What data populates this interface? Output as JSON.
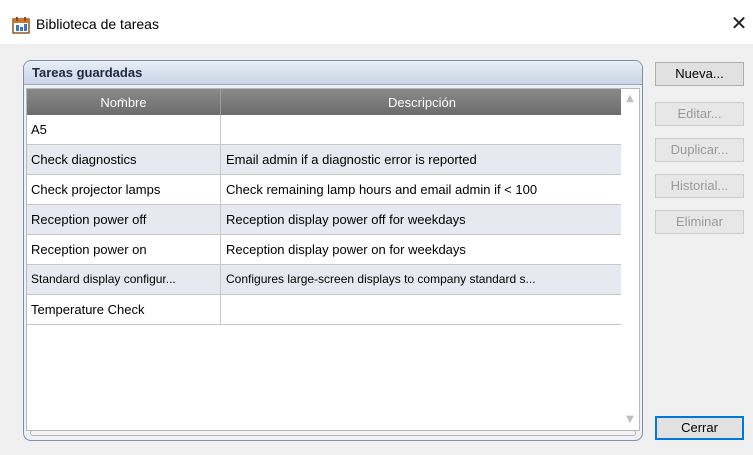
{
  "window": {
    "title": "Biblioteca de tareas",
    "title_icon": "task-library-icon",
    "close_glyph": "✕"
  },
  "group": {
    "title": "Tareas guardadas"
  },
  "table": {
    "columns": [
      "Nombre",
      "Descripción"
    ],
    "sort_indicator": "^",
    "rows": [
      {
        "name": "A5",
        "description": ""
      },
      {
        "name": "Check diagnostics",
        "description": "Email admin if a diagnostic error is reported"
      },
      {
        "name": "Check projector lamps",
        "description": "Check remaining lamp hours and email admin if < 100"
      },
      {
        "name": "Reception power off",
        "description": "Reception display power off for weekdays"
      },
      {
        "name": "Reception power on",
        "description": "Reception display power on for weekdays"
      },
      {
        "name": "Standard display configur...",
        "description": "Configures large-screen displays to company standard s..."
      },
      {
        "name": "Temperature Check",
        "description": ""
      }
    ]
  },
  "buttons": {
    "new": "Nueva...",
    "edit": "Editar...",
    "duplicate": "Duplicar...",
    "history": "Historial...",
    "delete": "Eliminar",
    "close": "Cerrar"
  }
}
